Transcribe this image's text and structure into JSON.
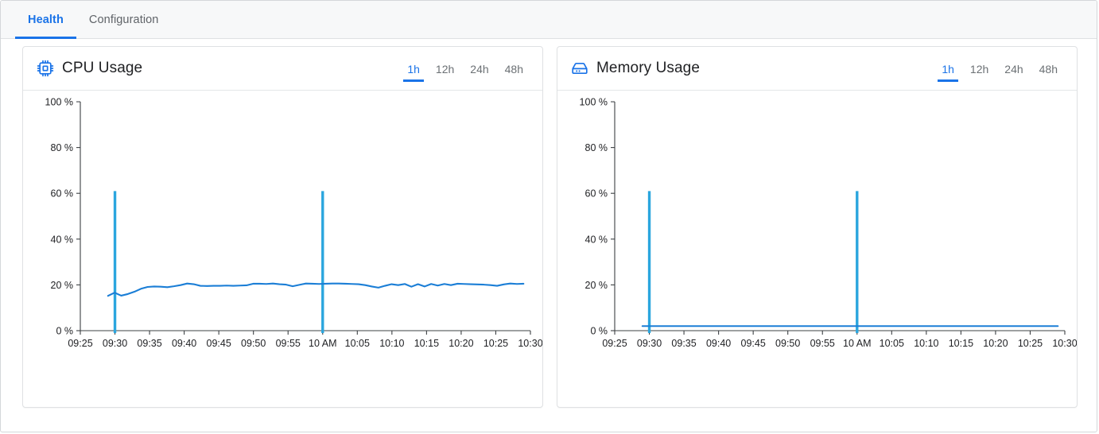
{
  "tabs": [
    {
      "label": "Health",
      "active": true
    },
    {
      "label": "Configuration",
      "active": false
    }
  ],
  "colors": {
    "accent": "#1a73e8",
    "line": "#1b7ed6",
    "spike": "#2ba6de",
    "axis": "#3c4043",
    "card_border": "#dfe1e3",
    "tabbar_bg": "#f7f8f9"
  },
  "cards": [
    {
      "title": "CPU Usage",
      "icon": "cpu-chip-icon",
      "ranges": [
        {
          "label": "1h",
          "active": true
        },
        {
          "label": "12h",
          "active": false
        },
        {
          "label": "24h",
          "active": false
        },
        {
          "label": "48h",
          "active": false
        }
      ]
    },
    {
      "title": "Memory Usage",
      "icon": "hard-drive-icon",
      "ranges": [
        {
          "label": "1h",
          "active": true
        },
        {
          "label": "12h",
          "active": false
        },
        {
          "label": "24h",
          "active": false
        },
        {
          "label": "48h",
          "active": false
        }
      ]
    }
  ],
  "chart_data": [
    {
      "type": "line",
      "title": "CPU Usage",
      "xlabel": "",
      "ylabel": "",
      "ylim": [
        0,
        100
      ],
      "ytick_labels": [
        "0 %",
        "20 %",
        "40 %",
        "60 %",
        "80 %",
        "100 %"
      ],
      "ytick_values": [
        0,
        20,
        40,
        60,
        80,
        100
      ],
      "xtick_labels": [
        "09:25",
        "09:30",
        "09:35",
        "09:40",
        "09:45",
        "09:50",
        "09:55",
        "10 AM",
        "10:05",
        "10:10",
        "10:15",
        "10:20",
        "10:25",
        "10:30"
      ],
      "grid": false,
      "legend": "none",
      "series": [
        {
          "name": "CPU usage",
          "x_start": "09:29",
          "x_end": "10:29",
          "values": [
            15.2,
            16.6,
            15.3,
            16.0,
            17.0,
            18.3,
            19.1,
            19.3,
            19.2,
            19.0,
            19.4,
            19.9,
            20.6,
            20.3,
            19.6,
            19.5,
            19.6,
            19.6,
            19.7,
            19.6,
            19.7,
            19.8,
            20.5,
            20.5,
            20.4,
            20.6,
            20.3,
            20.1,
            19.4,
            20.0,
            20.6,
            20.5,
            20.4,
            20.5,
            20.6,
            20.6,
            20.5,
            20.4,
            20.3,
            19.9,
            19.3,
            18.8,
            19.6,
            20.3,
            19.9,
            20.4,
            19.2,
            20.3,
            19.3,
            20.4,
            19.7,
            20.4,
            19.9,
            20.5,
            20.4,
            20.3,
            20.2,
            20.1,
            19.9,
            19.6,
            20.2,
            20.6,
            20.4,
            20.5
          ]
        }
      ],
      "annotations": [
        {
          "name": "spike",
          "x": "09:30",
          "value": 61
        },
        {
          "name": "spike",
          "x": "10 AM",
          "value": 61
        }
      ]
    },
    {
      "type": "line",
      "title": "Memory Usage",
      "xlabel": "",
      "ylabel": "",
      "ylim": [
        0,
        100
      ],
      "ytick_labels": [
        "0 %",
        "20 %",
        "40 %",
        "60 %",
        "80 %",
        "100 %"
      ],
      "ytick_values": [
        0,
        20,
        40,
        60,
        80,
        100
      ],
      "xtick_labels": [
        "09:25",
        "09:30",
        "09:35",
        "09:40",
        "09:45",
        "09:50",
        "09:55",
        "10 AM",
        "10:05",
        "10:10",
        "10:15",
        "10:20",
        "10:25",
        "10:30"
      ],
      "grid": false,
      "legend": "none",
      "series": [
        {
          "name": "Memory usage",
          "x_start": "09:29",
          "x_end": "10:29",
          "values": [
            2.0,
            2.0,
            2.0,
            2.0,
            2.0,
            2.0,
            2.0,
            2.0,
            2.0,
            2.0,
            2.0,
            2.0,
            2.0,
            2.0,
            2.0,
            2.0,
            2.0,
            2.0,
            2.0,
            2.0,
            2.0,
            2.0,
            2.0,
            2.0,
            2.0,
            2.0,
            2.0,
            2.0,
            2.0,
            2.0,
            2.0,
            2.0,
            2.0,
            2.0,
            2.0,
            2.0,
            2.0,
            2.0,
            2.0,
            2.0,
            2.0,
            2.0,
            2.0,
            2.0,
            2.0,
            2.0,
            2.0,
            2.0,
            2.0,
            2.0,
            2.0,
            2.0,
            2.0,
            2.0,
            2.0,
            2.0,
            2.0,
            2.0,
            2.0,
            2.0,
            2.0,
            2.0,
            2.0,
            2.0
          ]
        }
      ],
      "annotations": [
        {
          "name": "spike",
          "x": "09:30",
          "value": 61
        },
        {
          "name": "spike",
          "x": "10 AM",
          "value": 61
        }
      ]
    }
  ]
}
